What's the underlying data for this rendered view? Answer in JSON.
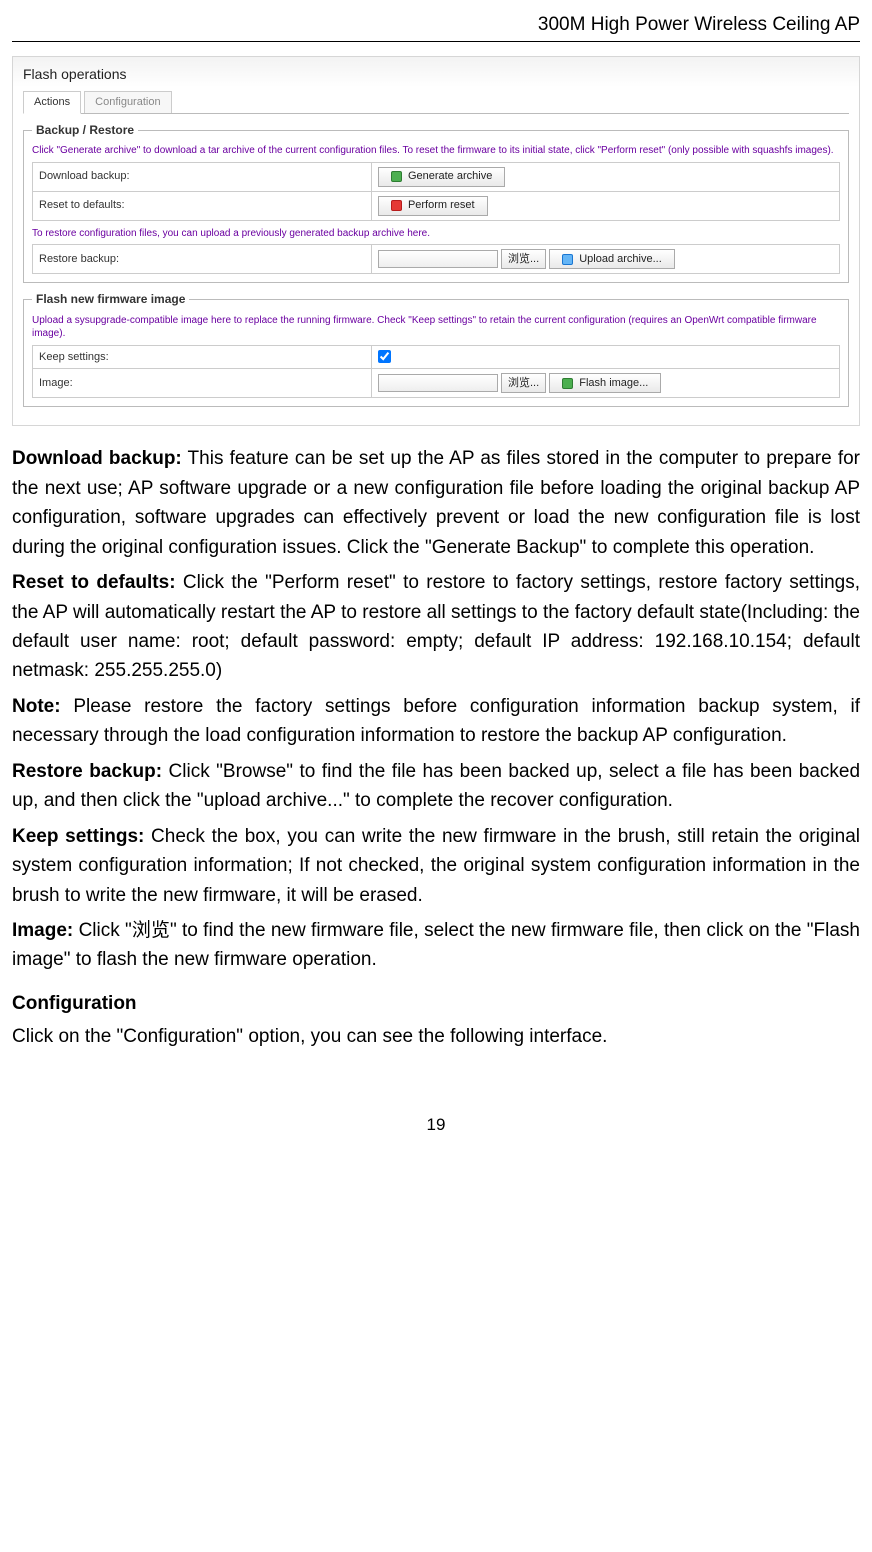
{
  "header": {
    "title": "300M High Power Wireless Ceiling AP"
  },
  "panel": {
    "title": "Flash operations",
    "tabs": {
      "active": "Actions",
      "inactive": "Configuration"
    },
    "backup": {
      "legend": "Backup / Restore",
      "hint1": "Click \"Generate archive\" to download a tar archive of the current configuration files. To reset the firmware to its initial state, click \"Perform reset\" (only possible with squashfs images).",
      "row1_label": "Download backup:",
      "row1_btn": "Generate archive",
      "row2_label": "Reset to defaults:",
      "row2_btn": "Perform reset",
      "hint2": "To restore configuration files, you can upload a previously generated backup archive here.",
      "row3_label": "Restore backup:",
      "row3_browse": "浏览...",
      "row3_btn": "Upload archive..."
    },
    "flash": {
      "legend": "Flash new firmware image",
      "hint": "Upload a sysupgrade-compatible image here to replace the running firmware. Check \"Keep settings\" to retain the current configuration (requires an OpenWrt compatible firmware image).",
      "row1_label": "Keep settings:",
      "row2_label": "Image:",
      "row2_browse": "浏览...",
      "row2_btn": "Flash image..."
    }
  },
  "doc": {
    "p1_strong": "Download backup:",
    "p1": " This feature can be set up the AP as files stored in the computer to prepare for the next use; AP software upgrade or a new configuration file before loading the original backup AP configuration, software upgrades can effectively prevent or load the new configuration file is lost during the original configuration issues. Click the \"Generate Backup\" to complete this operation.",
    "p2_strong": "Reset to defaults:",
    "p2": " Click the \"Perform reset\" to restore to factory settings, restore factory settings, the AP will automatically restart the AP to restore all settings to the factory default state(Including: the default user name: root; default password: empty; default IP address: 192.168.10.154; default netmask: 255.255.255.0)",
    "p3_strong": "Note:",
    "p3": " Please restore the factory settings before configuration information backup system, if necessary through the load configuration information to restore the backup AP configuration.",
    "p4_strong": "Restore backup:",
    "p4": " Click \"Browse\" to find the file has been backed up, select a file has been backed up, and then click the \"upload archive...\" to complete the recover configuration.",
    "p5_strong": "Keep settings:",
    "p5": " Check the box, you can write the new firmware in the brush, still retain the original system configuration information; If not checked, the original system configuration information in the brush to write the new firmware, it will be erased.",
    "p6_strong": "Image:",
    "p6": " Click \"浏览\" to find the new firmware file, select the new firmware file, then click on the \"Flash image\" to flash the new firmware operation.",
    "sub_heading": "Configuration",
    "p7": "Click on the \"Configuration\" option, you can see the following interface."
  },
  "page_number": "19"
}
